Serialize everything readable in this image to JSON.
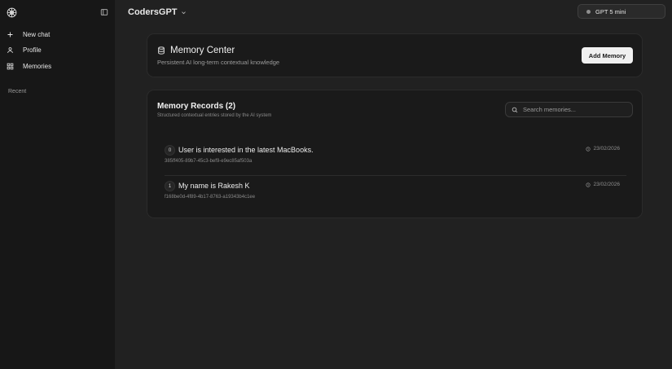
{
  "sidebar": {
    "items": [
      {
        "label": "New chat",
        "icon": "plus-icon"
      },
      {
        "label": "Profile",
        "icon": "user-icon"
      },
      {
        "label": "Memories",
        "icon": "grid-icon"
      }
    ],
    "recent_label": "Recent"
  },
  "header": {
    "app_title": "CodersGPT",
    "model_label": "GPT 5 mini"
  },
  "memory_center": {
    "title": "Memory Center",
    "subtitle": "Persistent AI long-term contextual knowledge",
    "add_button": "Add Memory"
  },
  "records": {
    "title": "Memory Records (2)",
    "subtitle": "Structured contextual entries stored by the AI system",
    "search_placeholder": "Search memories...",
    "items": [
      {
        "index": "0",
        "text": "User is interested in the latest MacBooks.",
        "id": "385ff405-89b7-45c3-bef9-e9ec85af503a",
        "date": "23/02/2026"
      },
      {
        "index": "1",
        "text": "My name is Rakesh K",
        "id": "f168be0d-4f89-4b17-8763-a19343b4c1ee",
        "date": "23/02/2026"
      }
    ]
  },
  "colors": {
    "background": "#212121",
    "sidebar": "#171717",
    "card": "#1a1a1a",
    "button": "#f0f0f0"
  }
}
